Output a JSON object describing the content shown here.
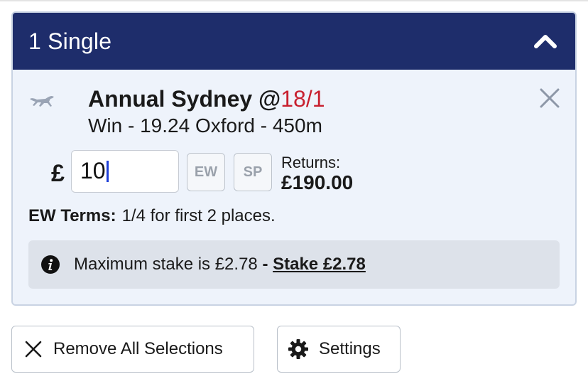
{
  "betslip": {
    "header_title": "1 Single",
    "collapse_icon": "chevron-up-icon"
  },
  "selection": {
    "runner": "Annual Sydney",
    "at": "@",
    "odds": "18/1",
    "market": "Win - 19.24 Oxford - 450m",
    "icon": "greyhound-icon"
  },
  "stake": {
    "currency": "£",
    "value": "10",
    "ew_label": "EW",
    "sp_label": "SP",
    "returns_label": "Returns:",
    "returns_value": "£190.00"
  },
  "ew_terms": {
    "label": "EW Terms:",
    "value": "1/4 for first 2 places."
  },
  "alert": {
    "message": "Maximum stake is £2.78",
    "separator": "-",
    "link": "Stake £2.78"
  },
  "actions": {
    "remove_all": "Remove All Selections",
    "settings": "Settings"
  },
  "colors": {
    "header_bg": "#1e2d6b",
    "odds": "#c8202f",
    "panel_bg": "#eef3fb",
    "alert_bg": "#dde2ea"
  }
}
